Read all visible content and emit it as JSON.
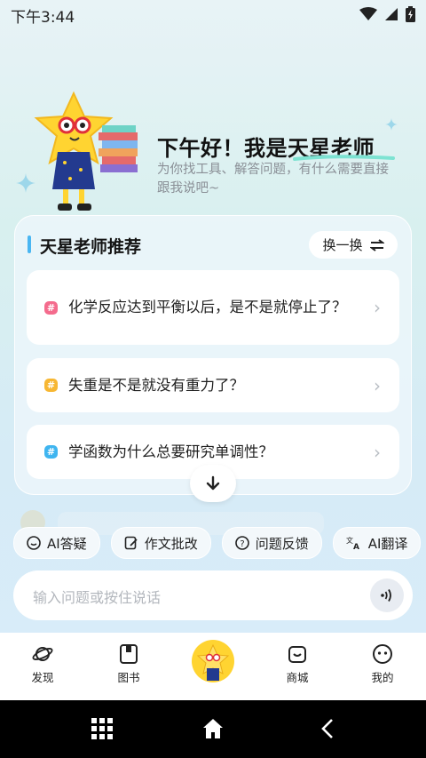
{
  "status": {
    "time": "下午3:44"
  },
  "greeting": {
    "title": "下午好！我是天星老师",
    "subtitle": "为你找工具、解答问题，有什么需要直接跟我说吧~"
  },
  "recommend": {
    "title": "天星老师推荐",
    "swap_label": "换一换",
    "questions": [
      {
        "text": "化学反应达到平衡以后，是不是就停止了？",
        "icon_color": "#f46b8d"
      },
      {
        "text": "失重是不是就没有重力了？",
        "icon_color": "#f7b733"
      },
      {
        "text": "学函数为什么总要研究单调性？",
        "icon_color": "#3fb5f0"
      }
    ]
  },
  "chips": [
    {
      "label": "AI答疑",
      "icon": "chat-bubble-icon"
    },
    {
      "label": "作文批改",
      "icon": "edit-document-icon"
    },
    {
      "label": "问题反馈",
      "icon": "question-bubble-icon"
    },
    {
      "label": "AI翻译",
      "icon": "translate-icon"
    }
  ],
  "input": {
    "placeholder": "输入问题或按住说话"
  },
  "tabs": [
    {
      "label": "发现",
      "icon": "planet-icon"
    },
    {
      "label": "图书",
      "icon": "book-icon"
    },
    {
      "label": "",
      "icon": "star-mascot-icon"
    },
    {
      "label": "商城",
      "icon": "shop-bag-icon"
    },
    {
      "label": "我的",
      "icon": "profile-face-icon"
    }
  ],
  "colors": {
    "accent": "#49b6f2",
    "mascot_yellow": "#ffd431",
    "title_underline": "#7de3d2"
  }
}
